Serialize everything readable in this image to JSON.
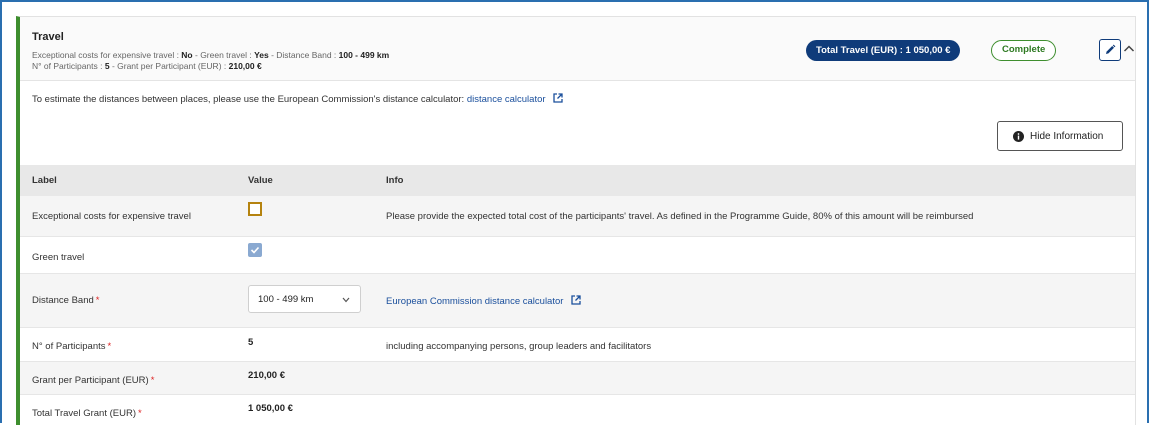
{
  "header": {
    "title": "Travel",
    "summary_line1": {
      "l1": "Exceptional costs for expensive travel : ",
      "v1": "No",
      "l2": " - Green travel : ",
      "v2": "Yes",
      "l3": " - Distance Band : ",
      "v3": "100 - 499 km"
    },
    "summary_line2": {
      "l1": "N° of Participants : ",
      "v1": "5",
      "l2": " - Grant per Participant (EUR) : ",
      "v2": "210,00 €"
    },
    "total_badge": "Total Travel (EUR) : 1 050,00 €",
    "status_badge": "Complete",
    "colors": {
      "accent_navy": "#0f3b7a",
      "complete_green": "#3e8e2e"
    }
  },
  "info": {
    "text": "To estimate the distances between places, please use the European Commission's distance calculator: ",
    "link": "distance calculator",
    "hide_button": "Hide Information"
  },
  "table": {
    "headers": {
      "label": "Label",
      "value": "Value",
      "info": "Info"
    },
    "rows": {
      "exceptional": {
        "label": "Exceptional costs for expensive travel",
        "checked": false,
        "info": "Please provide the expected total cost of the participants' travel. As defined in the Programme Guide, 80% of this amount will be reimbursed"
      },
      "green": {
        "label": "Green travel",
        "checked": true
      },
      "distance": {
        "label": "Distance Band",
        "selected": "100 - 499 km",
        "info_link": "European Commission distance calculator"
      },
      "participants": {
        "label": "N° of Participants",
        "value": "5",
        "info": "including accompanying persons, group leaders and facilitators"
      },
      "grant": {
        "label": "Grant per Participant (EUR)",
        "value": "210,00 €"
      },
      "total": {
        "label": "Total Travel Grant (EUR)",
        "value": "1 050,00 €"
      }
    },
    "required_mark": "*"
  },
  "icons": {
    "edit": "pencil-icon",
    "collapse": "chevron-up-icon",
    "external": "external-link-icon",
    "info": "info-circle-icon",
    "select": "chevron-down-icon",
    "check": "checkmark-icon"
  }
}
